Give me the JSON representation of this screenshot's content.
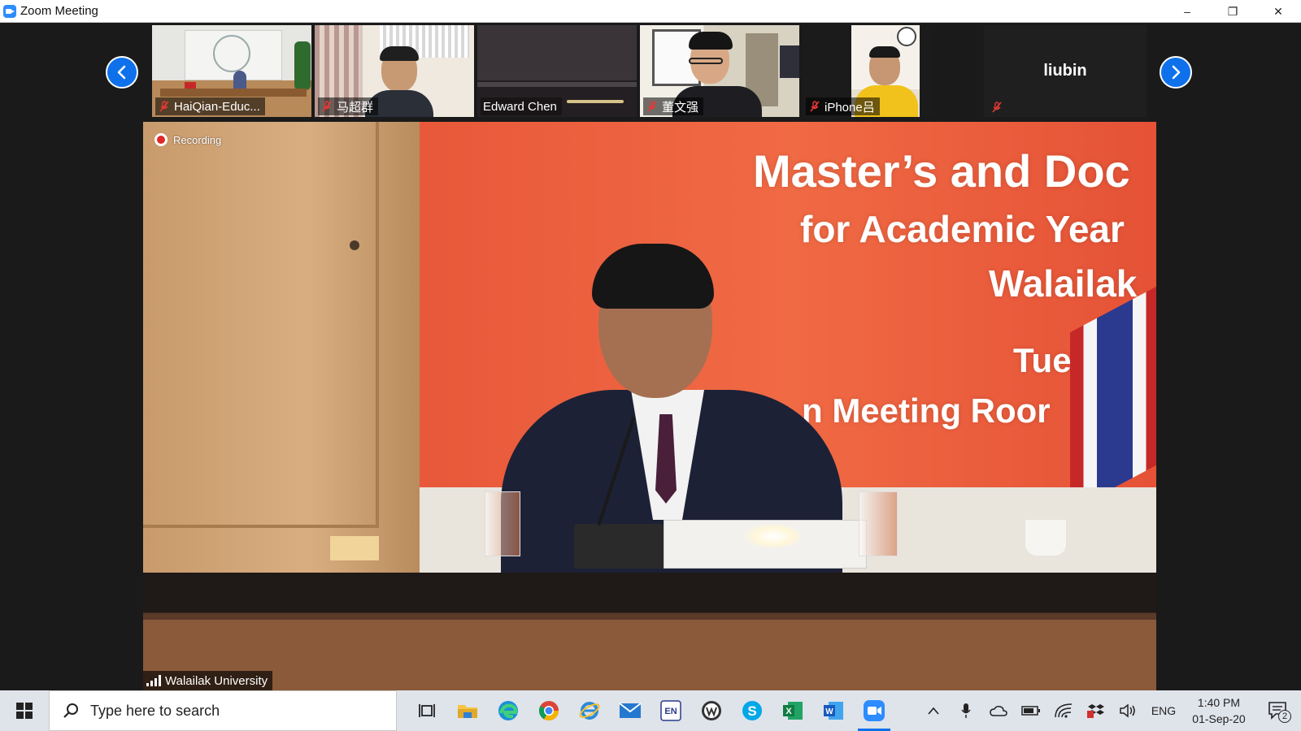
{
  "window": {
    "title": "Zoom Meeting",
    "controls": {
      "minimize": "–",
      "restore": "❐",
      "close": "✕"
    }
  },
  "thumbnails": [
    {
      "name": "HaiQian-Educ...",
      "muted": true
    },
    {
      "name": "马超群",
      "muted": true
    },
    {
      "name": "Edward Chen",
      "muted": false
    },
    {
      "name": "董文强",
      "muted": true
    },
    {
      "name": "iPhone吕",
      "muted": true
    }
  ],
  "name_only_participant": {
    "name": "liubin",
    "muted": true
  },
  "main_video": {
    "recording_label": "Recording",
    "speaker_name": "Walailak University",
    "banner_lines": [
      "Master’s and Doc",
      "for Academic Year",
      "Walailak",
      "Tuesd",
      "n Meeting Roor"
    ]
  },
  "taskbar": {
    "search_placeholder": "Type here to search",
    "apps": [
      "task-view",
      "file-explorer",
      "edge",
      "chrome",
      "internet-explorer",
      "mail",
      "en-dictionary",
      "wps",
      "skype",
      "excel",
      "word",
      "zoom"
    ],
    "tray": {
      "language": "ENG",
      "time": "1:40 PM",
      "date": "01-Sep-20",
      "notification_count": "2"
    }
  },
  "colors": {
    "accent": "#0e71eb",
    "zoom_blue": "#2D8CFF",
    "banner_orange": "#e8583a",
    "recording_red": "#e02828"
  }
}
